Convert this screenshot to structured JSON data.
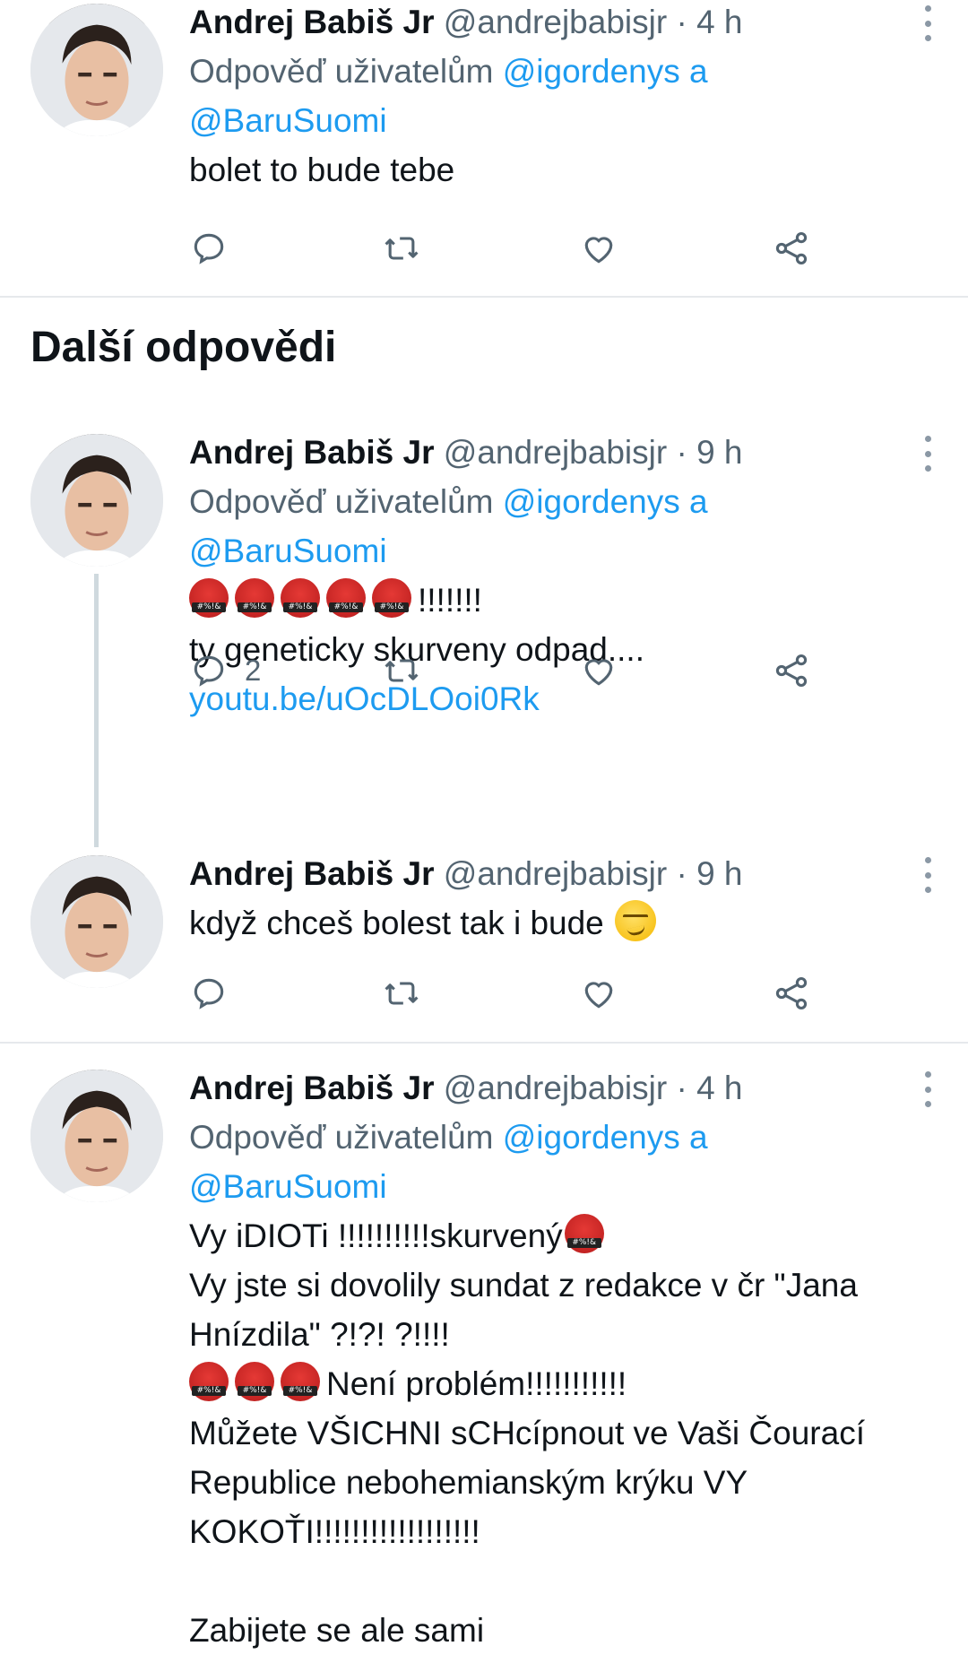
{
  "tweets": [
    {
      "name": "Andrej Babiš Jr",
      "handle": "@andrejbabisjr",
      "sep": "·",
      "time": "4 h",
      "reply_prefix": "Odpověď uživatelům",
      "mention1": "@igordenys",
      "conj": "a",
      "mention2": "@BaruSuomi",
      "text": "bolet to bude tebe"
    },
    {
      "name": "Andrej Babiš Jr",
      "handle": "@andrejbabisjr",
      "sep": "·",
      "time": "9 h",
      "reply_prefix": "Odpověď uživatelům",
      "mention1": "@igordenys",
      "conj": "a",
      "mention2": "@BaruSuomi",
      "text_exclaim": "!!!!!!!",
      "text_line2": "ty geneticky skurveny odpad....",
      "link": "youtu.be/uOcDLOoi0Rk",
      "reply_count": "2"
    },
    {
      "name": "Andrej Babiš Jr",
      "handle": "@andrejbabisjr",
      "sep": "·",
      "time": "9 h",
      "text": "když chceš bolest tak i bude"
    },
    {
      "name": "Andrej Babiš Jr",
      "handle": "@andrejbabisjr",
      "sep": "·",
      "time": "4 h",
      "reply_prefix": "Odpověď uživatelům",
      "mention1": "@igordenys",
      "conj": "a",
      "mention2": "@BaruSuomi",
      "line1": "Vy iDIOTi !!!!!!!!!!skurvený",
      "line2": "Vy jste si dovolily sundat z redakce v čr \"Jana Hnízdila\" ?!?! ?!!!!",
      "line3": "Není problém!!!!!!!!!!!",
      "line4": "Můžete VŠICHNI sCHcípnout ve Vaši Čourací Republice nebohemianským krýku VY KOKOŤI!!!!!!!!!!!!!!!!!!",
      "line5": "Zabijete se ale sami"
    }
  ],
  "section_title": "Další odpovědi",
  "icons": {
    "reply": "reply-icon",
    "retweet": "retweet-icon",
    "like": "heart-icon",
    "share": "share-icon",
    "more": "more-options-icon",
    "angry": "angry-swearing-emoji",
    "smirk": "smirking-face-emoji"
  },
  "colors": {
    "mention": "#1d9bf0",
    "secondary": "#536471",
    "divider": "#e6e9ec"
  }
}
